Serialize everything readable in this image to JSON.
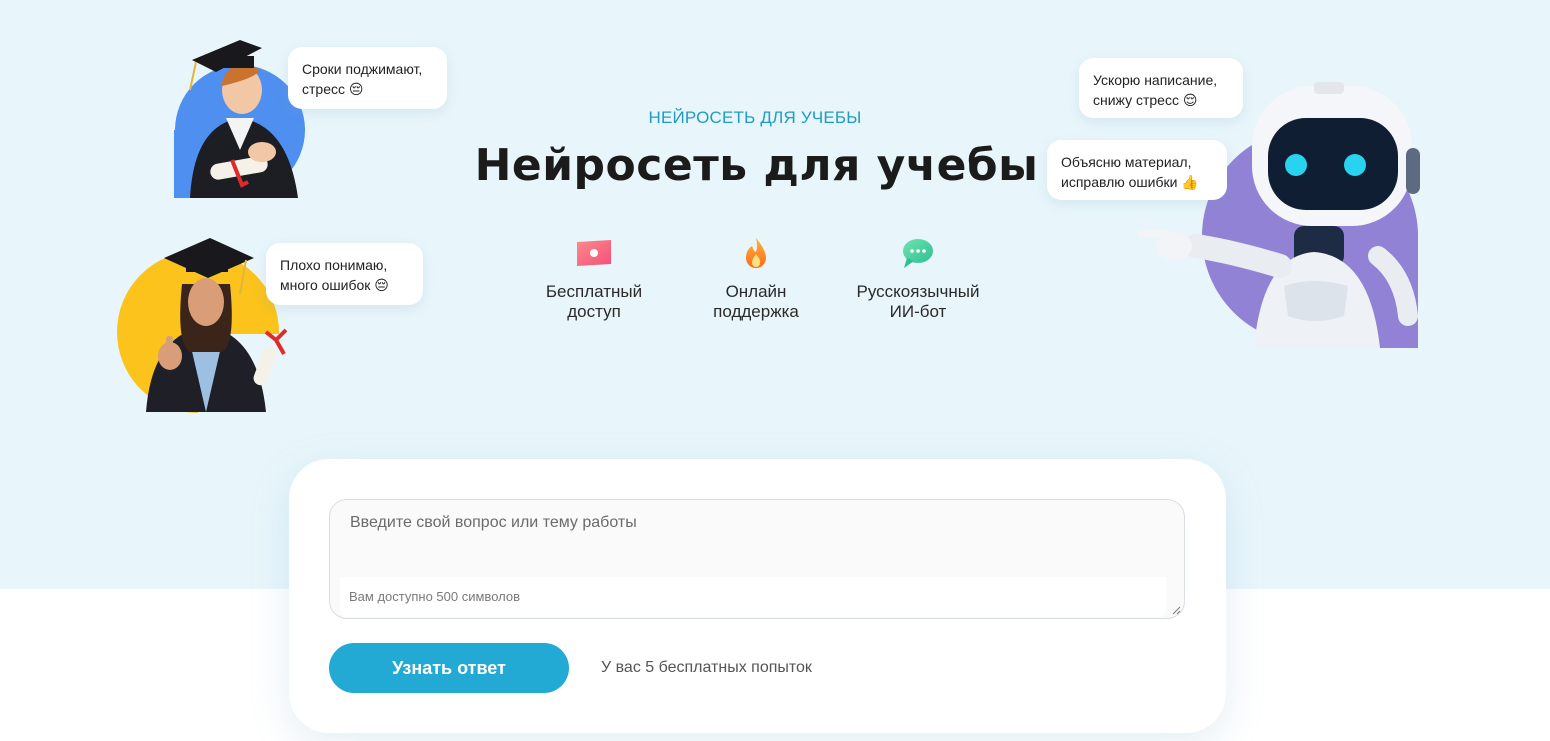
{
  "hero": {
    "subtitle": "НЕЙРОСЕТЬ ДЛЯ УЧЕБЫ",
    "title": "Нейросеть для учебы"
  },
  "features": [
    {
      "icon": "money-icon",
      "label": "Бесплатный\nдоступ"
    },
    {
      "icon": "flame-icon",
      "label": "Онлайн\nподдержка"
    },
    {
      "icon": "chat-bubble-icon",
      "label": "Русскоязычный\nИИ-бот"
    }
  ],
  "bubbles": {
    "student_male": "Сроки поджимают,\nстресс 😔",
    "student_female": "Плохо понимаю,\nмного ошибок 😔",
    "robot_speed": "Ускорю написание,\nснижу стресс 😌",
    "robot_explain": "Объясню материал,\nисправлю ошибки 👍"
  },
  "form": {
    "placeholder": "Введите свой вопрос или тему работы",
    "counter": "Вам доступно 500 символов",
    "submit_label": "Узнать ответ",
    "attempts": "У вас 5 бесплатных попыток"
  },
  "colors": {
    "accent": "#22a9d4",
    "hero_bg": "#e8f6fb",
    "blue_circle": "#4f8ff0",
    "yellow_circle": "#fbc31b",
    "purple_circle": "#9182d6"
  }
}
